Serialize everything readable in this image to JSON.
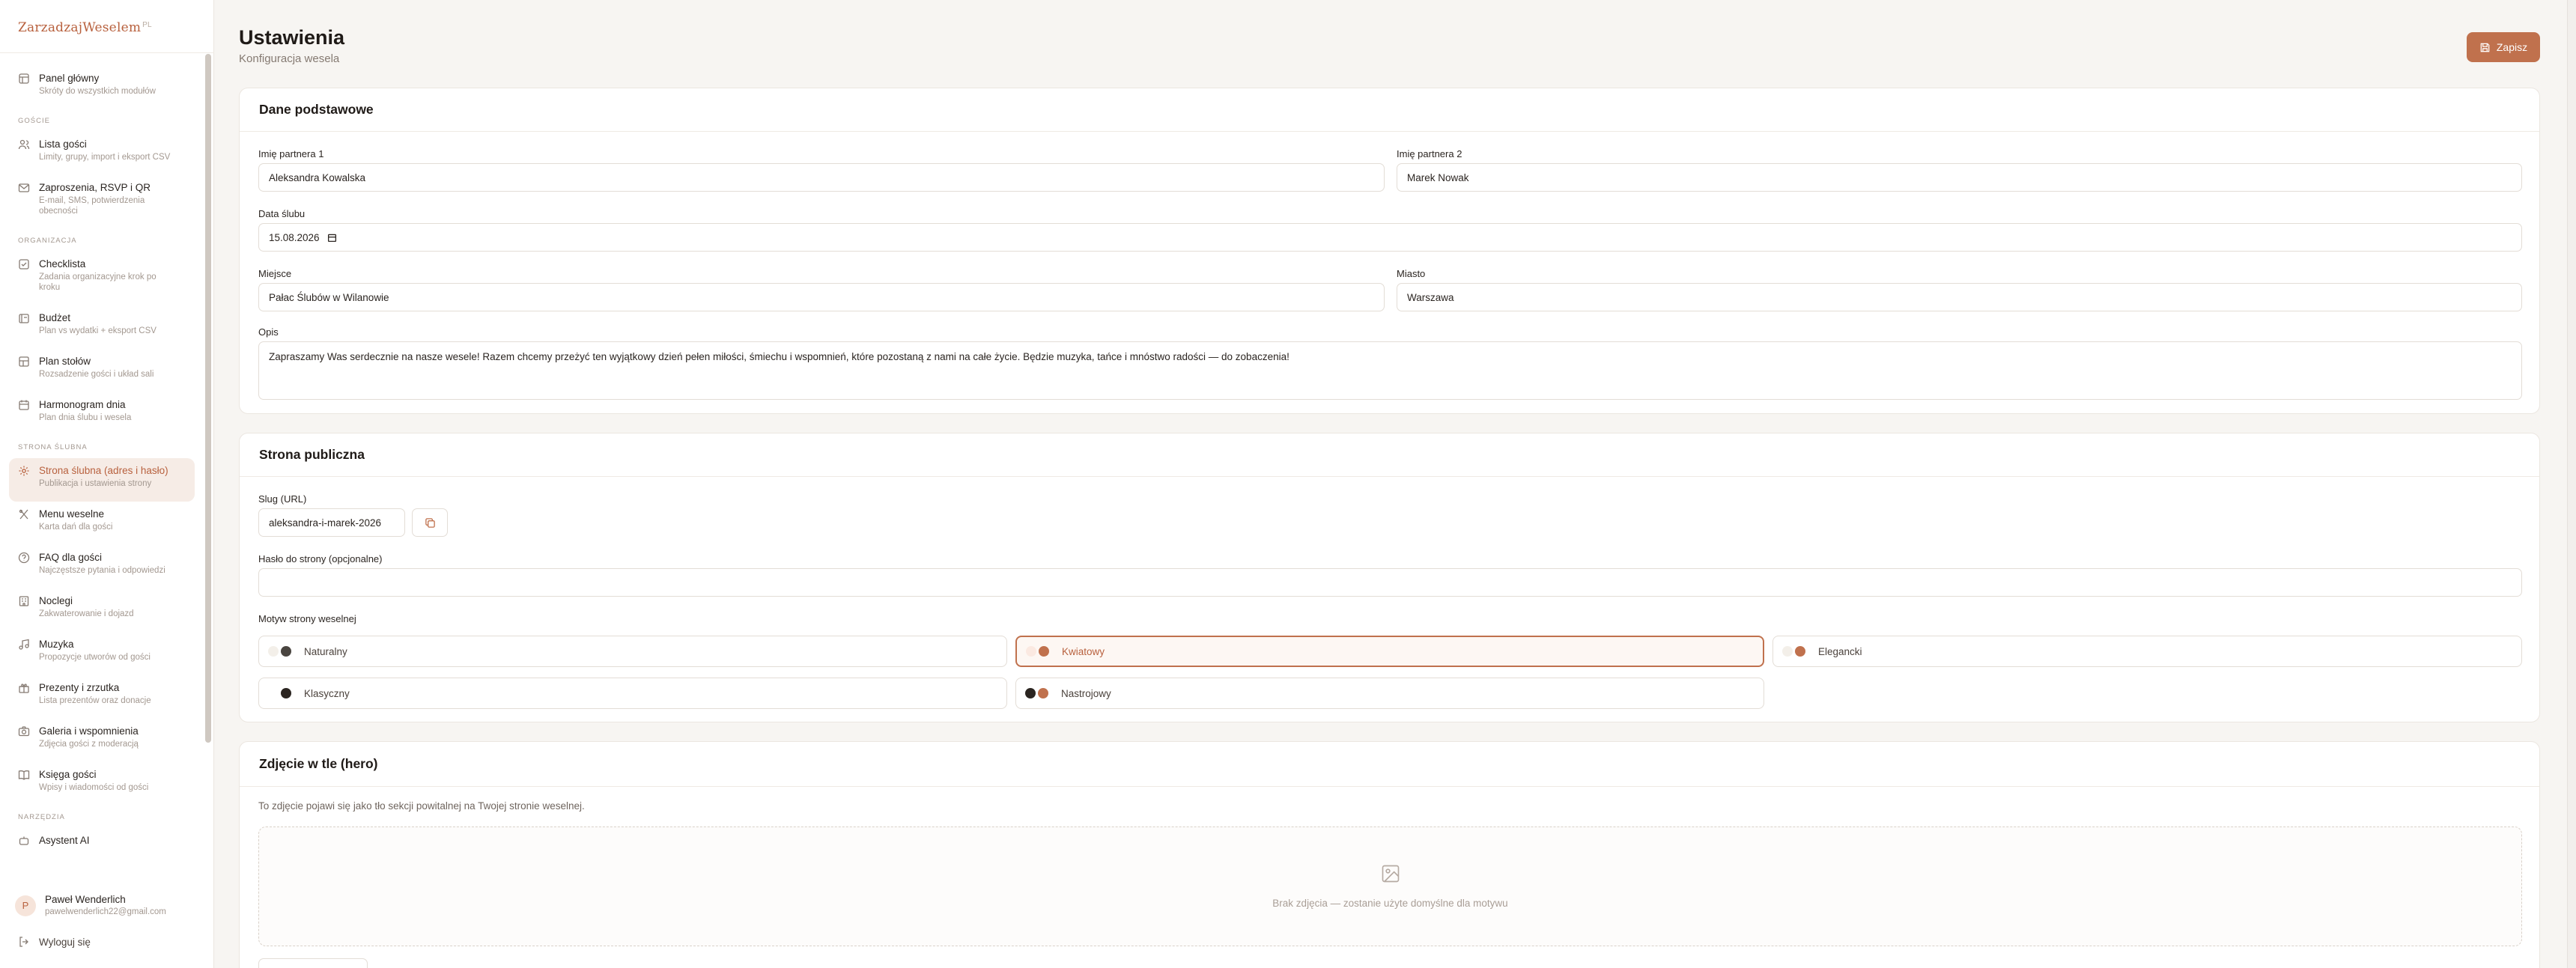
{
  "app": {
    "logo": "ZarzadzajWeselem",
    "logo_suffix": "PL"
  },
  "sidebar": {
    "top_item": {
      "title": "Panel główny",
      "sub": "Skróty do wszystkich modułów",
      "icon": "dashboard-icon"
    },
    "sections": [
      {
        "label": "GOŚCIE",
        "items": [
          {
            "title": "Lista gości",
            "sub": "Limity, grupy, import i eksport CSV",
            "icon": "users-icon"
          },
          {
            "title": "Zaproszenia, RSVP i QR",
            "sub": "E-mail, SMS, potwierdzenia obecności",
            "icon": "mail-icon"
          }
        ]
      },
      {
        "label": "ORGANIZACJA",
        "items": [
          {
            "title": "Checklista",
            "sub": "Zadania organizacyjne krok po kroku",
            "icon": "checklist-icon"
          },
          {
            "title": "Budżet",
            "sub": "Plan vs wydatki + eksport CSV",
            "icon": "wallet-icon"
          },
          {
            "title": "Plan stołów",
            "sub": "Rozsadzenie gości i układ sali",
            "icon": "table-layout-icon"
          },
          {
            "title": "Harmonogram dnia",
            "sub": "Plan dnia ślubu i wesela",
            "icon": "calendar-icon"
          }
        ]
      },
      {
        "label": "STRONA ŚLUBNA",
        "items": [
          {
            "title": "Strona ślubna (adres i hasło)",
            "sub": "Publikacja i ustawienia strony",
            "icon": "settings-icon",
            "active": true
          },
          {
            "title": "Menu weselne",
            "sub": "Karta dań dla gości",
            "icon": "utensils-icon"
          },
          {
            "title": "FAQ dla gości",
            "sub": "Najczęstsze pytania i odpowiedzi",
            "icon": "help-icon"
          },
          {
            "title": "Noclegi",
            "sub": "Zakwaterowanie i dojazd",
            "icon": "hotel-icon"
          },
          {
            "title": "Muzyka",
            "sub": "Propozycje utworów od gości",
            "icon": "music-icon"
          },
          {
            "title": "Prezenty i zrzutka",
            "sub": "Lista prezentów oraz donacje",
            "icon": "gift-icon"
          },
          {
            "title": "Galeria i wspomnienia",
            "sub": "Zdjęcia gości z moderacją",
            "icon": "camera-icon"
          },
          {
            "title": "Księga gości",
            "sub": "Wpisy i wiadomości od gości",
            "icon": "book-icon"
          }
        ]
      },
      {
        "label": "NARZĘDZIA",
        "items": [
          {
            "title": "Asystent AI",
            "sub": "",
            "icon": "bot-icon"
          }
        ]
      }
    ],
    "user": {
      "initial": "P",
      "name": "Paweł Wenderlich",
      "email": "pawelwenderlich22@gmail.com"
    },
    "logout": "Wyloguj się"
  },
  "header": {
    "title": "Ustawienia",
    "subtitle": "Konfiguracja wesela",
    "save": "Zapisz"
  },
  "basic": {
    "title": "Dane podstawowe",
    "partner1_label": "Imię partnera 1",
    "partner1": "Aleksandra Kowalska",
    "partner2_label": "Imię partnera 2",
    "partner2": "Marek Nowak",
    "date_label": "Data ślubu",
    "date": "15.08.2026",
    "venue_label": "Miejsce",
    "venue": "Pałac Ślubów w Wilanowie",
    "city_label": "Miasto",
    "city": "Warszawa",
    "desc_label": "Opis",
    "desc": "Zapraszamy Was serdecznie na nasze wesele! Razem chcemy przeżyć ten wyjątkowy dzień pełen miłości, śmiechu i wspomnień, które pozostaną z nami na całe życie. Będzie muzyka, tańce i mnóstwo radości — do zobaczenia!"
  },
  "public": {
    "title": "Strona publiczna",
    "slug_label": "Slug (URL)",
    "slug": "aleksandra-i-marek-2026",
    "password_label": "Hasło do strony (opcjonalne)",
    "password": "",
    "theme_label": "Motyw strony weselnej",
    "themes": [
      {
        "name": "Naturalny",
        "c1": "#f3efe9",
        "c2": "#4a4540"
      },
      {
        "name": "Kwiatowy",
        "c1": "#fbe9e1",
        "c2": "#c0714d",
        "selected": true
      },
      {
        "name": "Elegancki",
        "c1": "#f3efe9",
        "c2": "#c0714d"
      },
      {
        "name": "Klasyczny",
        "c1": "#ffffff",
        "c2": "#2b2521"
      },
      {
        "name": "Nastrojowy",
        "c1": "#2b2521",
        "c2": "#c0714d"
      }
    ]
  },
  "hero": {
    "title": "Zdjęcie w tle (hero)",
    "desc": "To zdjęcie pojawi się jako tło sekcji powitalnej na Twojej stronie weselnej.",
    "empty": "Brak zdjęcia — zostanie użyte domyślne dla motywu"
  },
  "colors": {
    "accent": "#c0714d",
    "accent_text": "#b8613e",
    "active_bg": "#f6ece6"
  }
}
